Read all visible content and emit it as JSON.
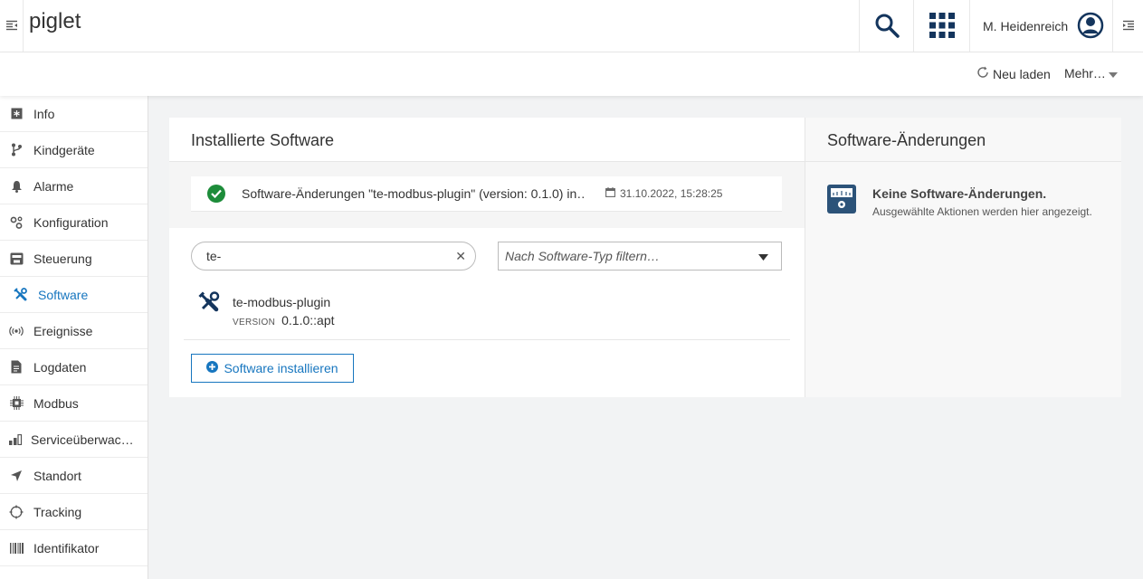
{
  "header": {
    "app_title": "piglet",
    "user_name": "M. Heidenreich"
  },
  "actionbar": {
    "reload_label": "Neu laden",
    "more_label": "Mehr…"
  },
  "sidebar": {
    "items": [
      {
        "label": "Info",
        "icon": "info-icon"
      },
      {
        "label": "Kindgeräte",
        "icon": "branch-icon"
      },
      {
        "label": "Alarme",
        "icon": "bell-icon"
      },
      {
        "label": "Konfiguration",
        "icon": "gears-icon"
      },
      {
        "label": "Steuerung",
        "icon": "control-icon"
      },
      {
        "label": "Software",
        "icon": "software-icon"
      },
      {
        "label": "Ereignisse",
        "icon": "broadcast-icon"
      },
      {
        "label": "Logdaten",
        "icon": "file-icon"
      },
      {
        "label": "Modbus",
        "icon": "chip-icon"
      },
      {
        "label": "Serviceüberwac…",
        "icon": "bars-icon"
      },
      {
        "label": "Standort",
        "icon": "location-arrow-icon"
      },
      {
        "label": "Tracking",
        "icon": "crosshair-icon"
      },
      {
        "label": "Identifikator",
        "icon": "barcode-icon"
      }
    ],
    "active_index": 5
  },
  "installed": {
    "title": "Installierte Software",
    "alert_text": "Software-Änderungen \"te-modbus-plugin\" (version: 0.1.0) in…",
    "alert_date": "31.10.2022, 15:28:25",
    "search_value": "te-",
    "filter_placeholder": "Nach Software-Typ filtern…",
    "software": [
      {
        "name": "te-modbus-plugin",
        "version_label": "VERSION",
        "version": "0.1.0::apt"
      }
    ],
    "install_label": "Software installieren"
  },
  "changes": {
    "title": "Software-Änderungen",
    "empty_title": "Keine Software-Änderungen.",
    "empty_sub": "Ausgewählte Aktionen werden hier angezeigt."
  },
  "colors": {
    "accent": "#1776bf",
    "success": "#1d8c3a",
    "dark_icon": "#14355d"
  }
}
